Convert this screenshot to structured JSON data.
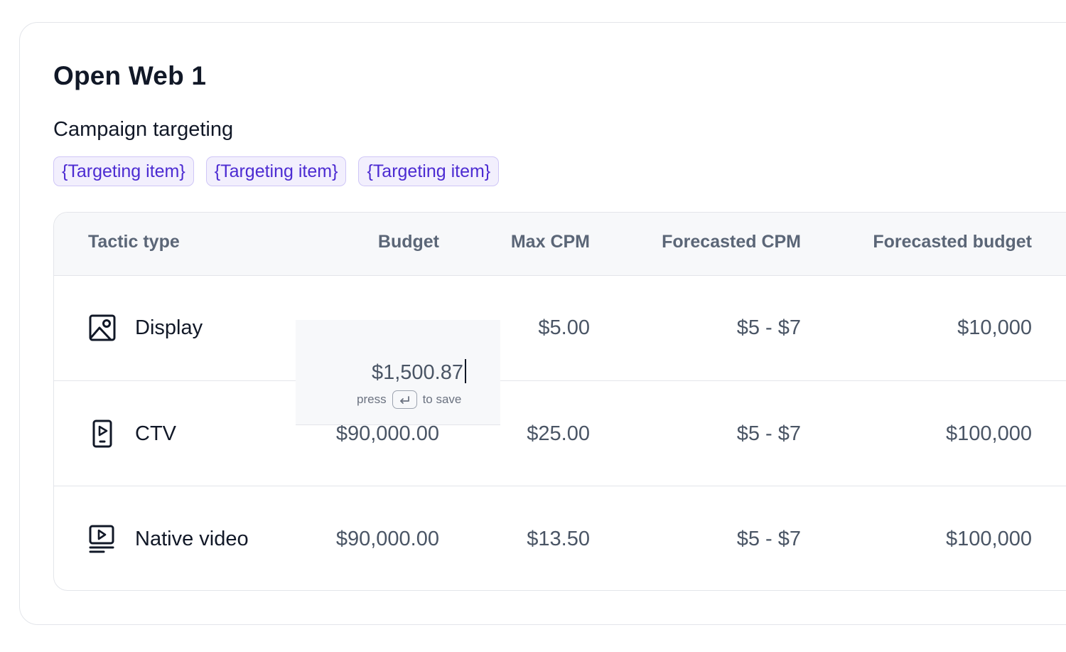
{
  "card": {
    "title": "Open Web 1",
    "targeting_heading": "Campaign targeting",
    "targeting_items": [
      "{Targeting item}",
      "{Targeting item}",
      "{Targeting item}"
    ]
  },
  "table": {
    "columns": [
      "Tactic type",
      "Budget",
      "Max CPM",
      "Forecasted CPM",
      "Forecasted budget"
    ],
    "rows": [
      {
        "icon": "image-icon",
        "tactic": "Display",
        "budget": "",
        "max_cpm": "$5.00",
        "forecasted_cpm": "$5 - $7",
        "forecasted_budget": "$10,000"
      },
      {
        "icon": "tablet-play-icon",
        "tactic": "CTV",
        "budget": "$90,000.00",
        "max_cpm": "$25.00",
        "forecasted_cpm": "$5 - $7",
        "forecasted_budget": "$100,000"
      },
      {
        "icon": "video-list-icon",
        "tactic": "Native video",
        "budget": "$90,000.00",
        "max_cpm": "$13.50",
        "forecasted_cpm": "$5 - $7",
        "forecasted_budget": "$100,000"
      }
    ]
  },
  "budget_editor": {
    "value": "$1,500.87",
    "hint_before": "press",
    "hint_key_icon": "enter-key-icon",
    "hint_after": "to save"
  },
  "colors": {
    "chip_text": "#4c2bd2",
    "chip_bg": "#f2effd",
    "chip_border": "#cfc6f7",
    "header_bg": "#f7f8fa",
    "border": "#e3e5ea"
  }
}
